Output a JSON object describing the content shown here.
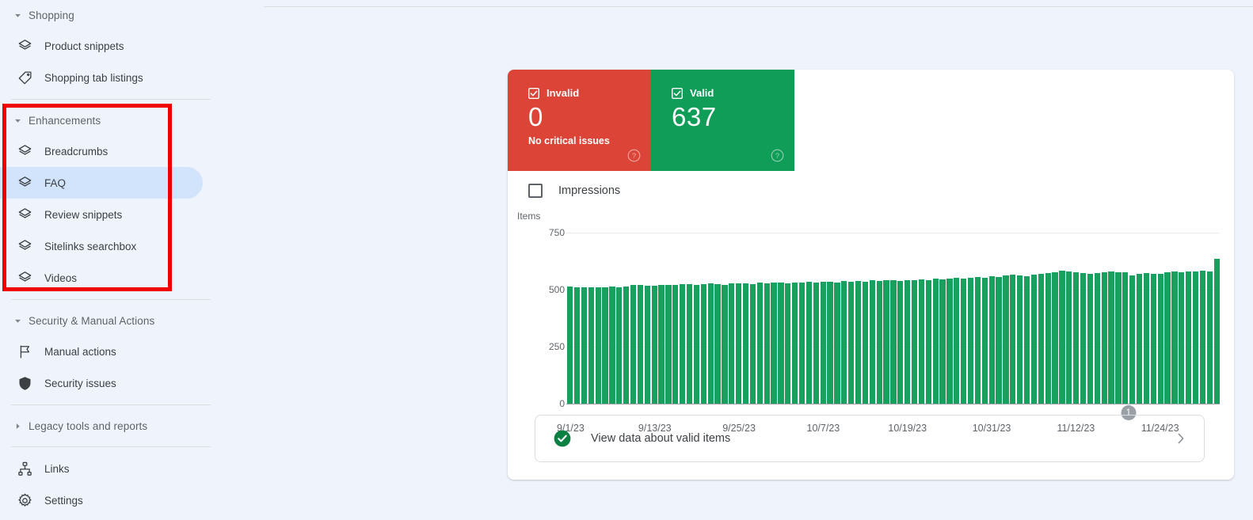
{
  "sidebar": {
    "groups": [
      {
        "id": "shopping",
        "label": "Shopping",
        "expanded": true,
        "caret": "caret-down-icon",
        "items": [
          {
            "label": "Product snippets",
            "icon": "layers-icon",
            "selected": false
          },
          {
            "label": "Shopping tab listings",
            "icon": "tag-icon",
            "selected": false
          }
        ]
      },
      {
        "id": "enhancements",
        "label": "Enhancements",
        "expanded": true,
        "caret": "caret-down-icon",
        "items": [
          {
            "label": "Breadcrumbs",
            "icon": "layers-icon",
            "selected": false
          },
          {
            "label": "FAQ",
            "icon": "layers-icon",
            "selected": true
          },
          {
            "label": "Review snippets",
            "icon": "layers-icon",
            "selected": false
          },
          {
            "label": "Sitelinks searchbox",
            "icon": "layers-icon",
            "selected": false
          },
          {
            "label": "Videos",
            "icon": "layers-icon",
            "selected": false
          }
        ]
      },
      {
        "id": "security",
        "label": "Security & Manual Actions",
        "expanded": true,
        "caret": "caret-down-icon",
        "items": [
          {
            "label": "Manual actions",
            "icon": "flag-icon",
            "selected": false
          },
          {
            "label": "Security issues",
            "icon": "shield-icon",
            "selected": false
          }
        ]
      },
      {
        "id": "legacy",
        "label": "Legacy tools and reports",
        "expanded": false,
        "caret": "caret-right-icon",
        "items": []
      }
    ],
    "footer_items": [
      {
        "label": "Links",
        "icon": "sitemap-icon",
        "selected": false
      },
      {
        "label": "Settings",
        "icon": "gear-icon",
        "selected": false
      }
    ]
  },
  "annotation": {
    "name": "red-highlight-box",
    "color": "#ee0000"
  },
  "status": {
    "invalid": {
      "label": "Invalid",
      "count": "0",
      "subtitle": "No critical issues",
      "color": "#db4437",
      "checkbox": "checked",
      "help": "help-icon"
    },
    "valid": {
      "label": "Valid",
      "count": "637",
      "subtitle": "",
      "color": "#0f9d58",
      "checkbox": "checked",
      "help": "help-icon"
    }
  },
  "impressions": {
    "label": "Impressions",
    "checked": false
  },
  "footer": {
    "label": "View data about valid items",
    "icon": "check-circle-icon",
    "chevron": "chevron-right-icon"
  },
  "chart_data": {
    "type": "bar",
    "title": "",
    "ylabel": "Items",
    "xlabel": "",
    "ylim": [
      0,
      750
    ],
    "yticks": [
      0,
      250,
      500,
      750
    ],
    "ytick_labels": [
      "0",
      "250",
      "500",
      "750"
    ],
    "grid": true,
    "legend": [
      "Valid"
    ],
    "series_color": "#17a05e",
    "x_tick_labels": [
      "9/1/23",
      "9/13/23",
      "9/25/23",
      "10/7/23",
      "10/19/23",
      "10/31/23",
      "11/12/23",
      "11/24/23"
    ],
    "x_tick_indices": [
      0,
      12,
      24,
      36,
      48,
      60,
      72,
      84
    ],
    "annotations": [
      {
        "label": "1",
        "index": 79
      }
    ],
    "x_start": "9/1/23",
    "x_end": "11/30/23",
    "values": [
      515,
      512,
      510,
      511,
      510,
      512,
      513,
      511,
      514,
      522,
      520,
      518,
      519,
      521,
      520,
      522,
      525,
      523,
      521,
      526,
      528,
      524,
      522,
      527,
      529,
      527,
      525,
      530,
      528,
      532,
      530,
      529,
      533,
      531,
      534,
      532,
      536,
      534,
      533,
      537,
      535,
      538,
      536,
      540,
      538,
      542,
      540,
      539,
      543,
      541,
      545,
      543,
      547,
      545,
      549,
      552,
      548,
      551,
      556,
      553,
      559,
      557,
      562,
      566,
      563,
      560,
      565,
      569,
      572,
      578,
      583,
      580,
      575,
      572,
      570,
      574,
      577,
      580,
      578,
      576,
      562,
      570,
      572,
      569,
      571,
      576,
      580,
      578,
      581,
      579,
      583,
      581,
      637
    ]
  }
}
